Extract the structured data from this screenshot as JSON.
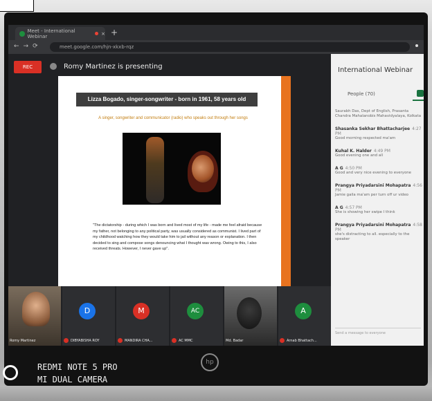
{
  "browser": {
    "tab_title": "Meet - International Webinar",
    "url": "meet.google.com/hjn-xkxb-rqz"
  },
  "meeting": {
    "rec_label": "REC",
    "presenting_text": "Romy Martinez is presenting"
  },
  "slide": {
    "title": "Lizza Bogado, singer-songwriter - born in 1961, 58 years old",
    "subtitle": "A singer, songwriter and communicator (radio) who speaks out through her songs",
    "quote": "\"The dictatorship - during which I was born and lived most of my life - made me feel afraid because my father, not belonging to any political party, was usually considered as communist. I lived part of my childhood watching how they would take him to jail without any reason or explanation. I then decided to sing and compose songs denouncing what I thought was wrong. Owing to this, I also received threats. However, I never gave up\"."
  },
  "participants": [
    {
      "name": "Romy Martinez",
      "initial": "",
      "color": ""
    },
    {
      "name": "DIBYABISHA ROY",
      "initial": "D",
      "color": "#1a73e8"
    },
    {
      "name": "MANDIRA CHA...",
      "initial": "M",
      "color": "#d93025"
    },
    {
      "name": "AC MMC",
      "initial": "AC",
      "color": "#1e8e3e"
    },
    {
      "name": "Md. Badar",
      "initial": "",
      "color": ""
    },
    {
      "name": "Arnab Bhattach...",
      "initial": "A",
      "color": "#1e8e3e"
    }
  ],
  "chat": {
    "title": "International Webinar",
    "people_label": "People (70)",
    "messages": [
      {
        "who": "",
        "time": "",
        "text": "Saurabh Das, Dept of English, Prasanta Chandra Mahalanobis Mahavidyalaya, Kolkata"
      },
      {
        "who": "Shasanka Sekhar Bhattacharjee",
        "time": "4:27 PM",
        "text": "Good morning respected ma'am"
      },
      {
        "who": "Kuhal K. Halder",
        "time": "4:49 PM",
        "text": "Good evening one and all"
      },
      {
        "who": "A G",
        "time": "4:50 PM",
        "text": "Good and very nice evening to everyone"
      },
      {
        "who": "Prangya Priyadarsini Mohapatra",
        "time": "4:56 PM",
        "text": "Jamie gaila ma'am per turn off ur video"
      },
      {
        "who": "A G",
        "time": "4:57 PM",
        "text": "She is showing her swipe I think"
      },
      {
        "who": "Prangya Priyadarsini Mohapatra",
        "time": "4:58 PM",
        "text": "she's distracting to all. especially to the speaker"
      }
    ],
    "input_placeholder": "Send a message to everyone"
  },
  "watermark": {
    "line1": "REDMI NOTE 5 PRO",
    "line2": "MI DUAL CAMERA"
  },
  "laptop": {
    "logo": "hp"
  }
}
